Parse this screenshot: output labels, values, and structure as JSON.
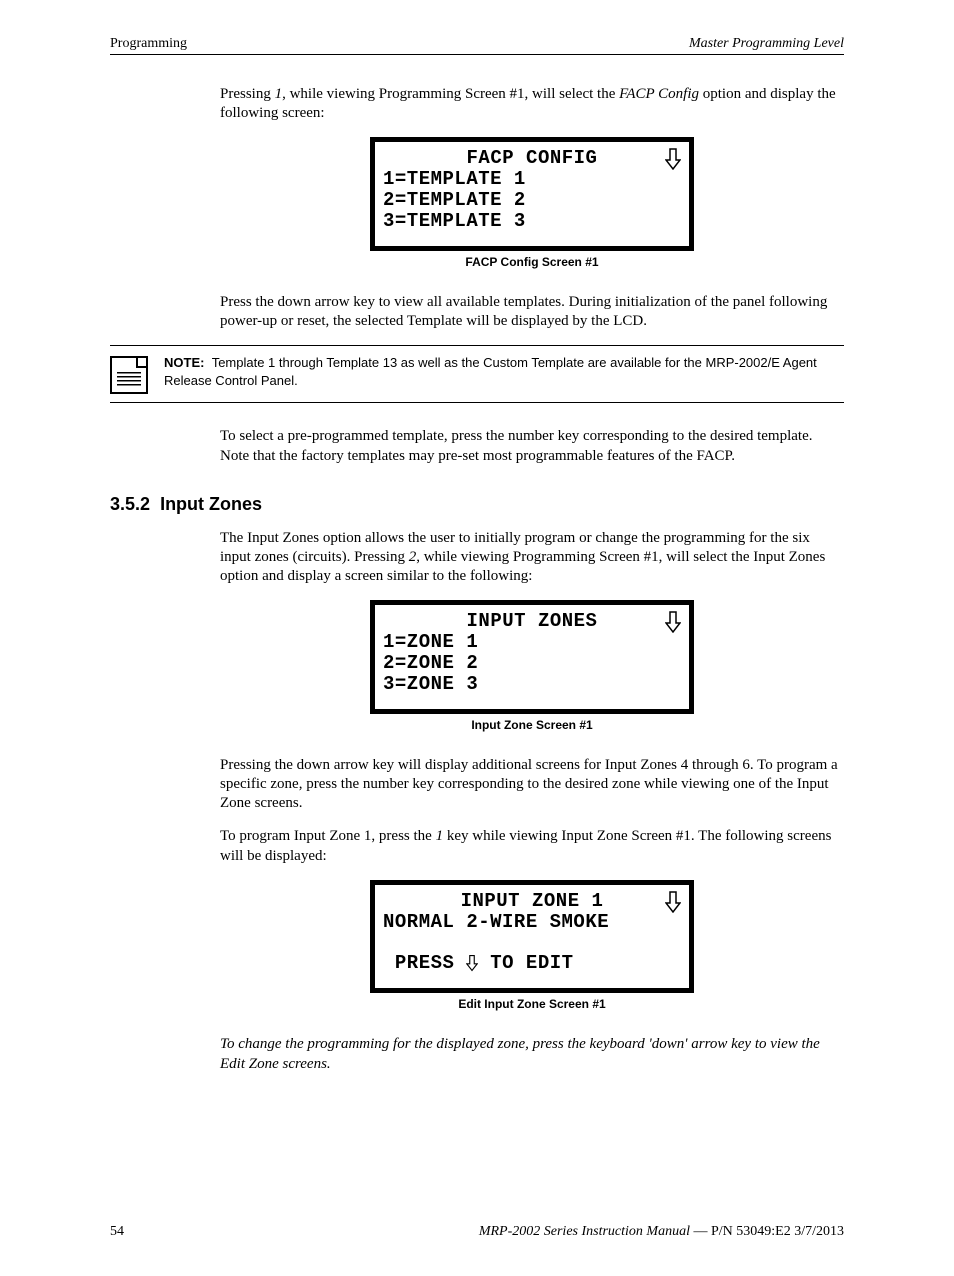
{
  "header": {
    "left": "Programming",
    "right": "Master Programming Level"
  },
  "intro": {
    "p1_a": "Pressing ",
    "p1_key": "1",
    "p1_b": ", while viewing Programming Screen #1, will select the ",
    "p1_ital": "FACP Config",
    "p1_c": " option and display the following screen:"
  },
  "lcd1": {
    "title": "FACP CONFIG",
    "line1": "1=TEMPLATE 1",
    "line2": "2=TEMPLATE 2",
    "line3": "3=TEMPLATE 3",
    "caption": "FACP Config Screen #1"
  },
  "after_lcd1": "Press the down arrow key to view all available templates.  During initialization of the panel following power-up or reset, the selected Template will be displayed by the LCD.",
  "note": {
    "label": "NOTE:",
    "text": "Template 1 through Template 13 as well as the Custom Template are available for the MRP-2002/E Agent Release Control Panel."
  },
  "after_note": "To select a pre-programmed template, press the number key corresponding to the desired template.  Note that the factory templates may pre-set most programmable features of the FACP.",
  "section": {
    "number": "3.5.2",
    "title": "Input Zones"
  },
  "zones_intro": {
    "a": " The Input Zones option allows the user to initially program or change the programming for the six input zones (circuits).  Pressing ",
    "key": "2",
    "b": ", while viewing Programming Screen #1, will select the Input Zones option and display a screen similar to the following:"
  },
  "lcd2": {
    "title": "INPUT ZONES",
    "line1": "1=ZONE 1",
    "line2": "2=ZONE 2",
    "line3": "3=ZONE 3",
    "caption": "Input Zone Screen #1"
  },
  "after_lcd2": "Pressing the down arrow key will display additional screens for Input Zones 4 through 6.  To program a specific zone, press the number key corresponding to the desired zone while viewing one of the Input Zone screens.",
  "zone1_intro": {
    "a": "To program Input Zone 1, press the ",
    "key": "1",
    "b": " key while viewing Input Zone Screen #1.  The following screens will be displayed:"
  },
  "lcd3": {
    "title": "INPUT ZONE 1",
    "line1": "NORMAL 2-WIRE SMOKE",
    "line3a": " PRESS ",
    "line3b": " TO EDIT",
    "caption": "Edit Input Zone Screen #1"
  },
  "closing_italic": "To change the programming for the displayed zone, press the keyboard 'down' arrow key to view the Edit Zone screens.",
  "footer": {
    "page": "54",
    "manual": "MRP-2002 Series Instruction Manual",
    "sep": " — ",
    "pn": "P/N 53049:E2  3/7/2013"
  }
}
